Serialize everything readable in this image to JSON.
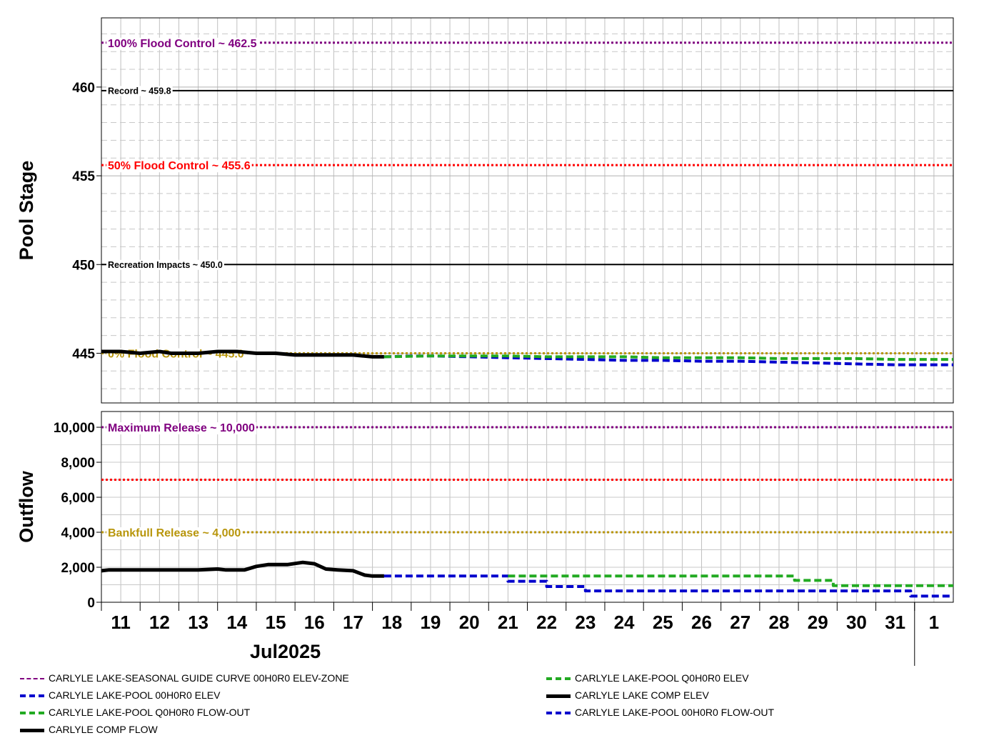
{
  "chart_data": [
    {
      "type": "line",
      "ylabel": "Pool Stage",
      "ylim": [
        442.2,
        463.9
      ],
      "yticks": [
        445,
        450,
        455,
        460
      ],
      "x_start_day": 10.5,
      "x_end_day": 32.5,
      "grid": true,
      "reference_lines": [
        {
          "label": "100% Flood Control ~ 462.5",
          "value": 462.5,
          "color": "#800080",
          "style": "dotted",
          "label_size": "big"
        },
        {
          "label": "Record ~ 459.8",
          "value": 459.8,
          "color": "#000000",
          "style": "solid",
          "label_size": "small"
        },
        {
          "label": "50% Flood Control ~ 455.6",
          "value": 455.6,
          "color": "#ff0000",
          "style": "dotted",
          "label_size": "big"
        },
        {
          "label": "Recreation Impacts ~ 450.0",
          "value": 450.0,
          "color": "#000000",
          "style": "solid",
          "label_size": "small"
        },
        {
          "label": "0% Flood Control ~ 445.0",
          "value": 445.0,
          "color": "#b8960c",
          "style": "dotted",
          "label_size": "big"
        }
      ],
      "series": [
        {
          "name": "CARLYLE LAKE COMP ELEV",
          "color": "#000000",
          "style": "solid",
          "x": [
            10.5,
            11.0,
            11.5,
            12.0,
            12.3,
            12.5,
            13.0,
            13.5,
            13.7,
            14.0,
            14.5,
            15.0,
            15.5,
            16.0,
            16.5,
            17.0,
            17.5,
            17.8
          ],
          "y": [
            445.1,
            445.1,
            445.0,
            445.1,
            445.0,
            445.0,
            445.0,
            445.1,
            445.1,
            445.1,
            445.0,
            445.0,
            444.9,
            444.9,
            444.9,
            444.9,
            444.8,
            444.8
          ]
        },
        {
          "name": "CARLYLE LAKE-POOL 00H0R0 ELEV",
          "color": "#0000cd",
          "style": "dashed",
          "x": [
            17.8,
            18.5,
            19.0,
            20.0,
            21.0,
            22.0,
            23.0,
            24.0,
            25.0,
            26.0,
            27.0,
            28.0,
            29.0,
            30.0,
            31.0,
            32.5
          ],
          "y": [
            444.8,
            444.85,
            444.85,
            444.8,
            444.75,
            444.7,
            444.65,
            444.6,
            444.6,
            444.55,
            444.55,
            444.5,
            444.45,
            444.4,
            444.35,
            444.35
          ]
        },
        {
          "name": "CARLYLE LAKE-POOL Q0H0R0 ELEV",
          "color": "#22aa22",
          "style": "dashed",
          "x": [
            17.8,
            19.0,
            20.0,
            21.0,
            22.0,
            23.0,
            24.0,
            25.0,
            26.0,
            27.0,
            28.0,
            29.0,
            30.0,
            31.0,
            32.5
          ],
          "y": [
            444.8,
            444.85,
            444.85,
            444.85,
            444.8,
            444.8,
            444.8,
            444.75,
            444.75,
            444.75,
            444.7,
            444.7,
            444.7,
            444.65,
            444.65
          ]
        }
      ]
    },
    {
      "type": "line",
      "ylabel": "Outflow",
      "ylim": [
        0,
        10900
      ],
      "yticks": [
        0,
        2000,
        4000,
        6000,
        8000,
        10000
      ],
      "ytick_labels": [
        "0",
        "2,000",
        "4,000",
        "6,000",
        "8,000",
        "10,000"
      ],
      "xticks": [
        11,
        12,
        13,
        14,
        15,
        16,
        17,
        18,
        19,
        20,
        21,
        22,
        23,
        24,
        25,
        26,
        27,
        28,
        29,
        30,
        31,
        32
      ],
      "xtick_labels": [
        "11",
        "12",
        "13",
        "14",
        "15",
        "16",
        "17",
        "18",
        "19",
        "20",
        "21",
        "22",
        "23",
        "24",
        "25",
        "26",
        "27",
        "28",
        "29",
        "30",
        "31",
        "1"
      ],
      "xlabel": "Jul2025",
      "grid": true,
      "reference_lines": [
        {
          "label": "Maximum Release ~ 10,000",
          "value": 10000,
          "color": "#800080",
          "style": "dotted",
          "label_size": "big"
        },
        {
          "label": "",
          "value": 7000,
          "color": "#ff0000",
          "style": "dotted",
          "label_size": "big"
        },
        {
          "label": "Bankfull Release ~ 4,000",
          "value": 4000,
          "color": "#b8960c",
          "style": "dotted",
          "label_size": "big"
        }
      ],
      "series": [
        {
          "name": "CARLYLE COMP FLOW",
          "color": "#000000",
          "style": "solid",
          "x": [
            10.5,
            10.7,
            11.0,
            12.0,
            13.0,
            13.5,
            13.7,
            14.2,
            14.5,
            14.8,
            15.0,
            15.3,
            15.7,
            16.0,
            16.3,
            16.6,
            17.0,
            17.3,
            17.5,
            17.8
          ],
          "y": [
            1800,
            1850,
            1850,
            1850,
            1850,
            1900,
            1850,
            1850,
            2050,
            2150,
            2150,
            2150,
            2280,
            2200,
            1900,
            1850,
            1800,
            1550,
            1500,
            1500
          ]
        },
        {
          "name": "CARLYLE LAKE-POOL 00H0R0 FLOW-OUT",
          "color": "#0000cd",
          "style": "dashed",
          "x": [
            17.8,
            21.0,
            21.0,
            22.0,
            22.0,
            23.0,
            23.0,
            31.4,
            31.4,
            32.5
          ],
          "y": [
            1500,
            1500,
            1200,
            1200,
            900,
            900,
            650,
            650,
            350,
            350
          ]
        },
        {
          "name": "CARLYLE LAKE-POOL Q0H0R0 FLOW-OUT",
          "color": "#22aa22",
          "style": "dashed",
          "x": [
            21.0,
            28.4,
            28.4,
            29.4,
            29.4,
            32.5
          ],
          "y": [
            1500,
            1500,
            1250,
            1250,
            950,
            950
          ]
        }
      ]
    }
  ],
  "legend": [
    {
      "label": "CARLYLE LAKE-SEASONAL GUIDE CURVE 00H0R0 ELEV-ZONE",
      "color": "#800080",
      "style": "dashdot"
    },
    {
      "label": "CARLYLE LAKE-POOL Q0H0R0 ELEV",
      "color": "#22aa22",
      "style": "dashed"
    },
    {
      "label": "CARLYLE LAKE-POOL 00H0R0 ELEV",
      "color": "#0000cd",
      "style": "dashed"
    },
    {
      "label": "CARLYLE LAKE COMP ELEV",
      "color": "#000000",
      "style": "solid"
    },
    {
      "label": "CARLYLE LAKE-POOL Q0H0R0 FLOW-OUT",
      "color": "#22aa22",
      "style": "dashed"
    },
    {
      "label": "CARLYLE LAKE-POOL 00H0R0 FLOW-OUT",
      "color": "#0000cd",
      "style": "dashed"
    },
    {
      "label": "CARLYLE COMP FLOW",
      "color": "#000000",
      "style": "solid"
    }
  ]
}
